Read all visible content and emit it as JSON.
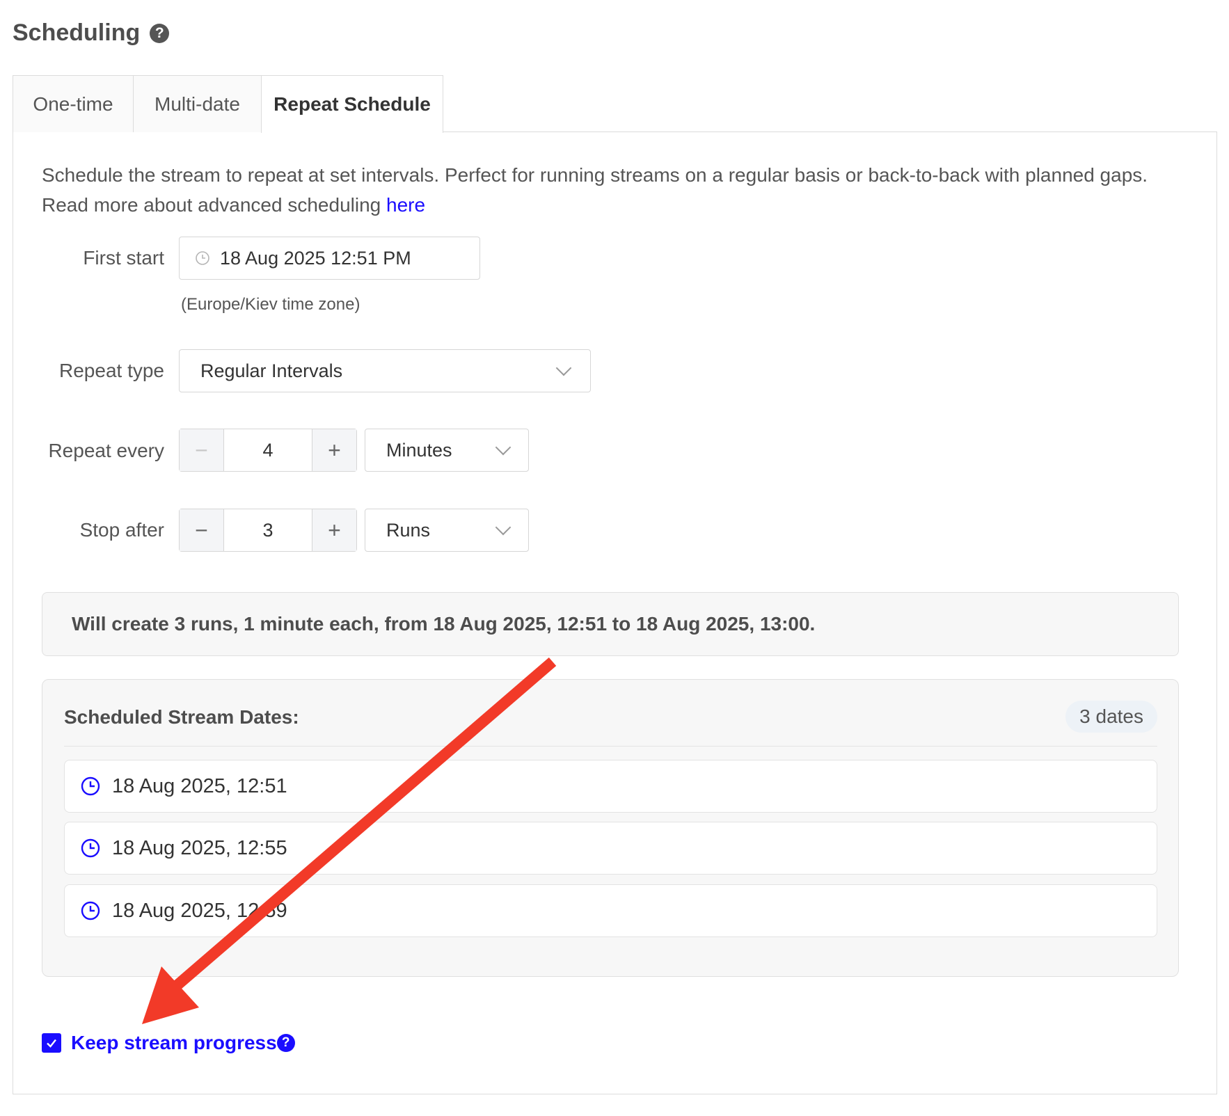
{
  "section": {
    "title": "Scheduling",
    "help_glyph": "?"
  },
  "tabs": [
    {
      "label": "One-time",
      "active": false
    },
    {
      "label": "Multi-date",
      "active": false
    },
    {
      "label": "Repeat Schedule",
      "active": true
    }
  ],
  "description": {
    "line1": "Schedule the stream to repeat at set intervals. Perfect for running streams on a regular basis or back-to-back with planned gaps.",
    "line2_prefix": "Read more about advanced scheduling ",
    "link_text": "here"
  },
  "first_start": {
    "label": "First start",
    "value": "18 Aug 2025 12:51 PM",
    "timezone_note": "(Europe/Kiev time zone)",
    "icon": "clock-icon"
  },
  "repeat_type": {
    "label": "Repeat type",
    "selected": "Regular Intervals"
  },
  "repeat_every": {
    "label": "Repeat every",
    "value": "4",
    "unit": "Minutes",
    "minus": "−",
    "plus": "+"
  },
  "stop_after": {
    "label": "Stop after",
    "value": "3",
    "unit": "Runs",
    "minus": "−",
    "plus": "+"
  },
  "summary": "Will create 3 runs, 1 minute each, from 18 Aug 2025, 12:51 to 18 Aug 2025, 13:00.",
  "scheduled_dates": {
    "title": "Scheduled Stream Dates:",
    "count_badge": "3 dates",
    "items": [
      "18 Aug 2025, 12:51",
      "18 Aug 2025, 12:55",
      "18 Aug 2025, 12:59"
    ]
  },
  "keep_progress": {
    "label": "Keep stream progress",
    "checked": true,
    "help_glyph": "?"
  },
  "colors": {
    "accent": "#1a0dff",
    "annotation_arrow": "#f23a28"
  }
}
